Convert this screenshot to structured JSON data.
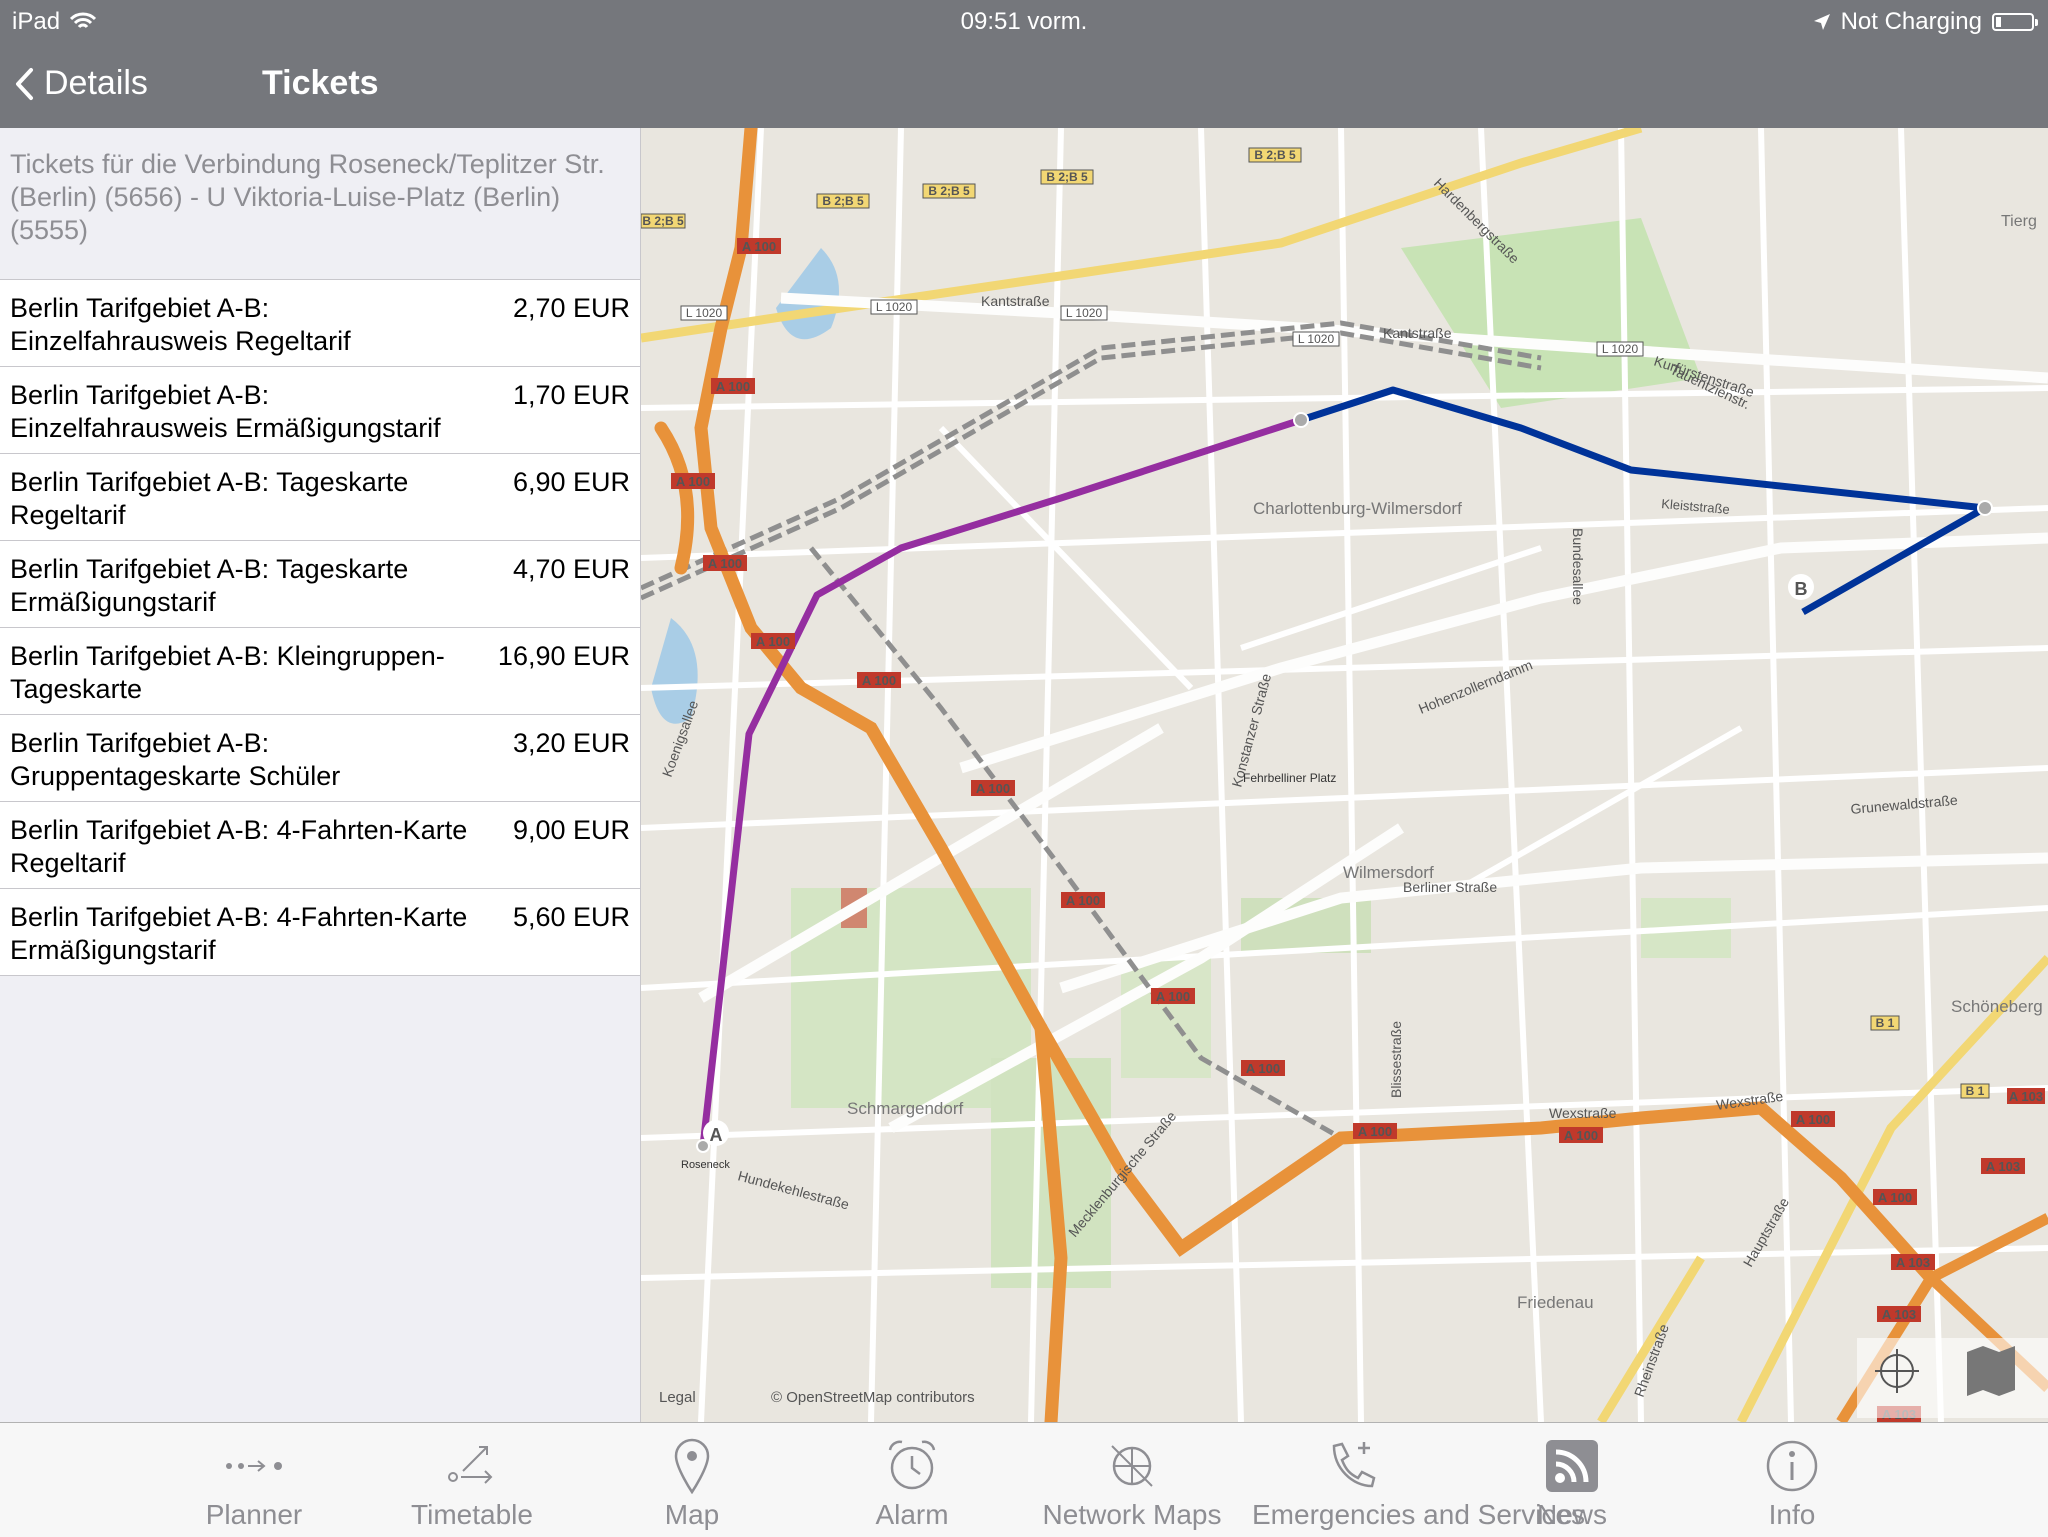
{
  "status": {
    "device": "iPad",
    "time": "09:51 vorm.",
    "charging": "Not Charging"
  },
  "nav": {
    "back_label": "Details",
    "title": "Tickets"
  },
  "header_text": "Tickets für die Verbindung Roseneck/Teplitzer Str. (Berlin) (5656) - U Viktoria-Luise-Platz (Berlin) (5555)",
  "tickets": [
    {
      "name": "Berlin Tarifgebiet A-B: Einzelfahrausweis Regeltarif",
      "price": "2,70 EUR"
    },
    {
      "name": "Berlin Tarifgebiet A-B: Einzelfahrausweis Ermäßigungstarif",
      "price": "1,70 EUR"
    },
    {
      "name": "Berlin Tarifgebiet A-B: Tageskarte Regeltarif",
      "price": "6,90 EUR"
    },
    {
      "name": "Berlin Tarifgebiet A-B: Tageskarte Ermäßigungstarif",
      "price": "4,70 EUR"
    },
    {
      "name": "Berlin Tarifgebiet A-B: Kleingruppen- Tageskarte",
      "price": "16,90 EUR"
    },
    {
      "name": "Berlin Tarifgebiet A-B: Gruppentageskarte Schüler",
      "price": "3,20 EUR"
    },
    {
      "name": "Berlin Tarifgebiet A-B: 4-Fahrten-Karte Regeltarif",
      "price": "9,00 EUR"
    },
    {
      "name": "Berlin Tarifgebiet A-B: 4-Fahrten-Karte Ermäßigungstarif",
      "price": "5,60 EUR"
    }
  ],
  "map": {
    "legal": "Legal",
    "attribution": "© OpenStreetMap contributors",
    "marker_start": "A",
    "marker_end": "B",
    "route_colors": {
      "segment1": "#952ea0",
      "segment2": "#003399"
    },
    "labels": {
      "kantstrasse1": "Kantstraße",
      "kantstrasse2": "Kantstraße",
      "kurfuerstenstrasse": "Kurfürstenstraße",
      "hardenbergstrasse": "Hardenbergstraße",
      "tauentzien": "Tauentzienstr.",
      "charlottenburg": "Charlottenburg-Wilmersdorf",
      "hohenzollerndamm": "Hohenzollerndamm",
      "bundesallee": "Bundesallee",
      "konstanzer": "Konstanzer Straße",
      "fehrbelliner": "Fehrbelliner Platz",
      "grunewaldstrasse": "Grunewaldstraße",
      "wilmersdorf": "Wilmersdorf",
      "berliner_strasse": "Berliner Straße",
      "koenigsallee": "Koenigsallee",
      "schmargendorf": "Schmargendorf",
      "hundekehle": "Hundekehlestraße",
      "roseneck": "Roseneck",
      "mecklenburgische": "Mecklenburgische Straße",
      "blissestrasse": "Blissestraße",
      "wexstrasse1": "Wexstraße",
      "wexstrasse2": "Wexstraße",
      "friedenau": "Friedenau",
      "hauptstrasse": "Hauptstraße",
      "schoeneberg": "Schöneberg",
      "rheinstrasse": "Rheinstraße",
      "tiergarten": "Tierg",
      "kleiststrasse": "Kleiststraße",
      "a100": "A 100",
      "a103": "A 103",
      "b1": "B 1",
      "b2b5": "B 2;B 5",
      "l1020": "L 1020"
    }
  },
  "tabs": [
    {
      "label": "Planner",
      "icon": "planner-icon"
    },
    {
      "label": "Timetable",
      "icon": "timetable-icon"
    },
    {
      "label": "Map",
      "icon": "map-pin-icon"
    },
    {
      "label": "Alarm",
      "icon": "alarm-icon"
    },
    {
      "label": "Network Maps",
      "icon": "network-maps-icon"
    },
    {
      "label": "Emergencies and Services",
      "icon": "phone-plus-icon"
    },
    {
      "label": "News",
      "icon": "rss-icon"
    },
    {
      "label": "Info",
      "icon": "info-icon"
    }
  ]
}
